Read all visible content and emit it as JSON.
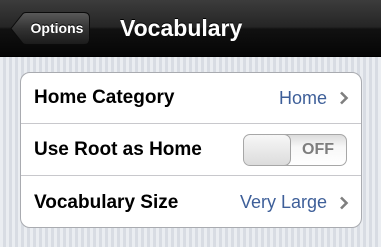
{
  "navbar": {
    "back_label": "Options",
    "title": "Vocabulary",
    "back_icon": "back-arrow-icon"
  },
  "settings": {
    "rows": [
      {
        "label": "Home Category",
        "value": "Home",
        "icon": "chevron-right-icon"
      },
      {
        "label": "Use Root as Home",
        "toggle": "OFF",
        "state": false
      },
      {
        "label": "Vocabulary Size",
        "value": "Very Large",
        "icon": "chevron-right-icon"
      }
    ]
  },
  "colors": {
    "value_text": "#3e5f99",
    "navbar": "#1a1a1a",
    "background": "#dfe3ea"
  }
}
